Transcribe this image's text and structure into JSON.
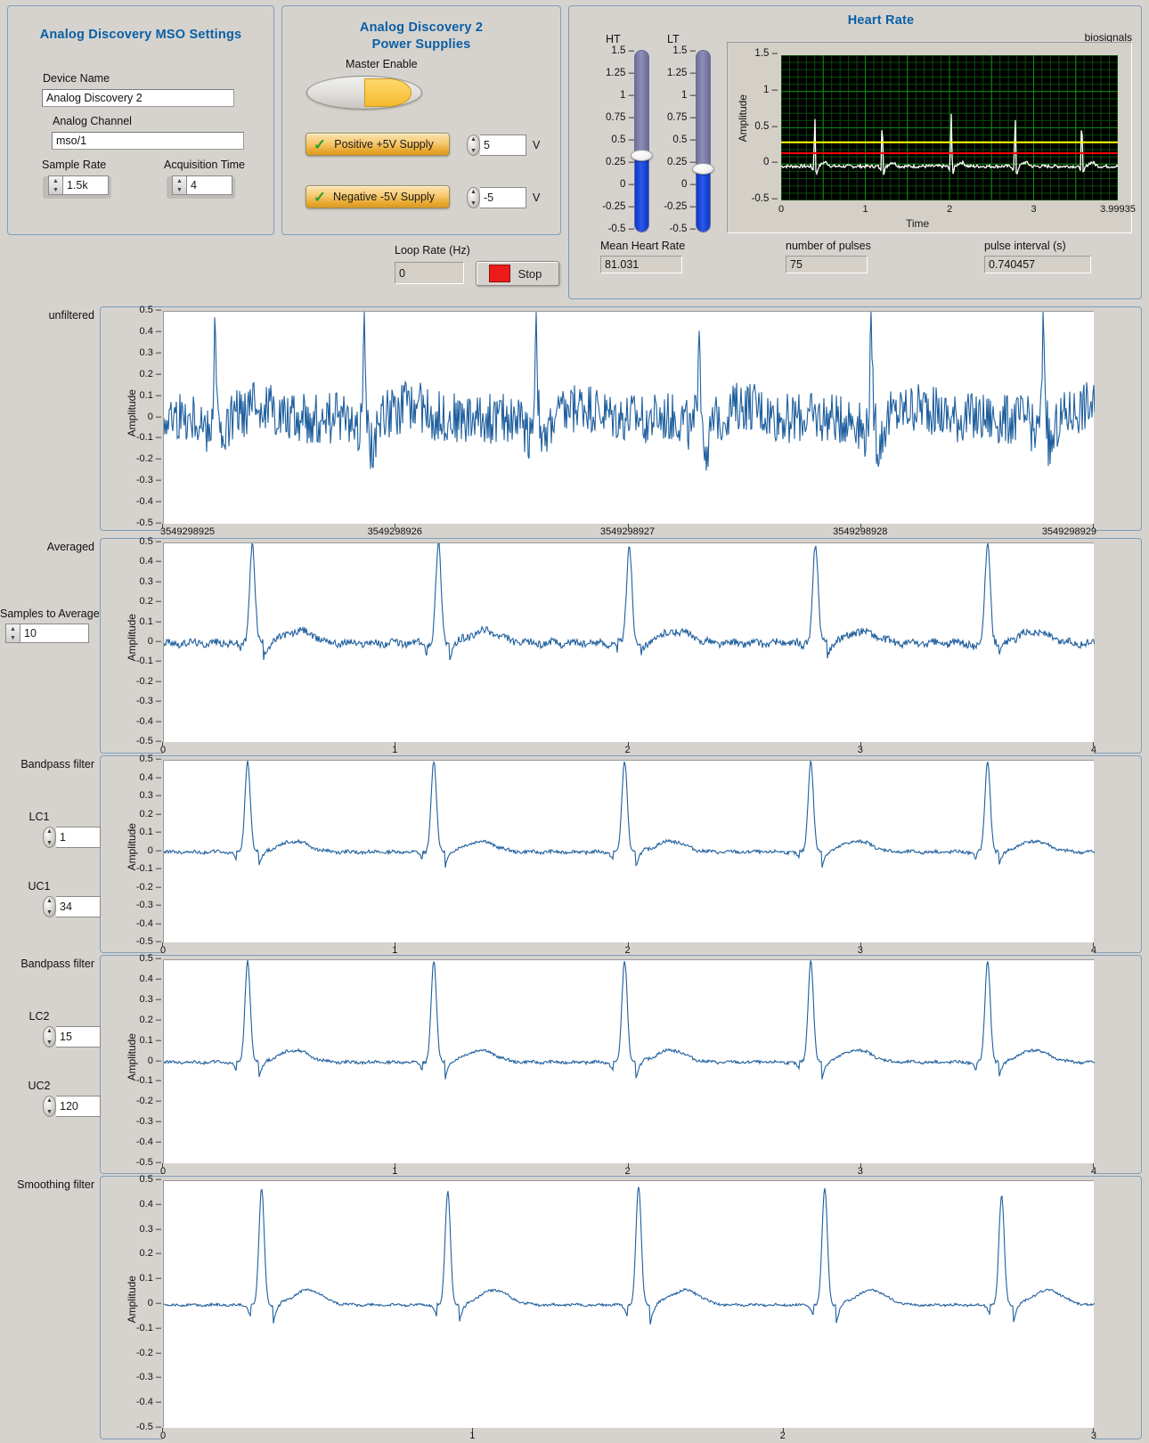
{
  "mso_settings": {
    "title": "Analog Discovery MSO Settings",
    "device_name_label": "Device Name",
    "device_name_value": "Analog Discovery 2",
    "analog_channel_label": "Analog Channel",
    "analog_channel_value": "mso/1",
    "sample_rate_label": "Sample Rate",
    "sample_rate_value": "1.5k",
    "acquisition_time_label": "Acquisition Time",
    "acquisition_time_value": "4"
  },
  "power_supplies": {
    "title_line1": "Analog Discovery 2",
    "title_line2": "Power Supplies",
    "master_enable_label": "Master Enable",
    "positive_supply_label": "Positive +5V Supply",
    "negative_supply_label": "Negative -5V Supply",
    "positive_voltage_value": "5",
    "negative_voltage_value": "-5",
    "volt_unit": "V"
  },
  "loop": {
    "loop_rate_label": "Loop Rate (Hz)",
    "loop_rate_value": "0",
    "stop_label": "Stop"
  },
  "heart_rate": {
    "title": "Heart Rate",
    "ht_label": "HT",
    "lt_label": "LT",
    "ht_value": 0.3,
    "lt_value": 0.15,
    "slider_ticks": [
      "1.5",
      "1.25",
      "1",
      "0.75",
      "0.5",
      "0.25",
      "0",
      "-0.25",
      "-0.5"
    ],
    "legend": "biosignals",
    "mean_heart_rate_label": "Mean Heart Rate",
    "mean_heart_rate_value": "81.031",
    "number_of_pulses_label": "number of pulses",
    "number_of_pulses_value": "75",
    "pulse_interval_label": "pulse interval (s)",
    "pulse_interval_value": "0.740457"
  },
  "chart_data": [
    {
      "type": "line",
      "name": "heart-rate-chart",
      "title": "",
      "xlabel": "Time",
      "ylabel": "Amplitude",
      "xlim": [
        0,
        3.99935
      ],
      "ylim": [
        -0.5,
        1.5
      ],
      "xticks": [
        "0",
        "1",
        "2",
        "3",
        "3.99935"
      ],
      "yticks": [
        "1.5",
        "1",
        "0.5",
        "0",
        "-0.5"
      ],
      "grid": true,
      "grid_color": "#0c6b0c",
      "background": "#000000",
      "trace_color": "#ffffff",
      "threshold_lines": [
        {
          "name": "HT",
          "value": 0.3,
          "color": "#ffff00"
        },
        {
          "name": "LT",
          "value": 0.15,
          "color": "#ff0000"
        }
      ],
      "peak_times": [
        0.4,
        1.2,
        2.02,
        2.78,
        3.57
      ],
      "peak_amplitudes": [
        0.7,
        0.66,
        0.72,
        0.67,
        0.66
      ]
    },
    {
      "type": "line",
      "name": "unfiltered-graph",
      "side_label": "unfiltered",
      "ylabel": "Amplitude",
      "ylim": [
        -0.5,
        0.5
      ],
      "yticks": [
        "0.5",
        "0.4",
        "0.3",
        "0.2",
        "0.1",
        "0",
        "-0.1",
        "-0.2",
        "-0.3",
        "-0.4",
        "-0.5"
      ],
      "xticks": [
        "3549298925",
        "3549298926",
        "3549298927",
        "3549298928",
        "3549298929"
      ],
      "trace_color": "#1f5f9e",
      "noise_amplitude": 0.12,
      "peak_positions": [
        0.055,
        0.215,
        0.4,
        0.575,
        0.76,
        0.945
      ],
      "peak_amplitudes": [
        0.5,
        0.5,
        0.5,
        0.5,
        0.5,
        0.5
      ]
    },
    {
      "type": "line",
      "name": "averaged-graph",
      "side_label": "Averaged",
      "ylabel": "Amplitude",
      "ylim": [
        -0.5,
        0.5
      ],
      "yticks": [
        "0.5",
        "0.4",
        "0.3",
        "0.2",
        "0.1",
        "0",
        "-0.1",
        "-0.2",
        "-0.3",
        "-0.4",
        "-0.5"
      ],
      "xticks": [
        "0",
        "1",
        "2",
        "3",
        "4"
      ],
      "trace_color": "#1f5f9e",
      "noise_amplitude": 0.03,
      "peak_positions": [
        0.095,
        0.295,
        0.5,
        0.7,
        0.885
      ],
      "peak_amplitudes": [
        0.5,
        0.5,
        0.5,
        0.5,
        0.5
      ],
      "control_label": "Samples to Average",
      "control_value": "10"
    },
    {
      "type": "line",
      "name": "bandpass-filter-1-graph",
      "side_label": "Bandpass filter",
      "ylabel": "Amplitude",
      "ylim": [
        -0.5,
        0.5
      ],
      "yticks": [
        "0.5",
        "0.4",
        "0.3",
        "0.2",
        "0.1",
        "0",
        "-0.1",
        "-0.2",
        "-0.3",
        "-0.4",
        "-0.5"
      ],
      "xticks": [
        "0",
        "1",
        "2",
        "3",
        "4"
      ],
      "trace_color": "#1f5f9e",
      "noise_amplitude": 0.015,
      "peak_positions": [
        0.09,
        0.29,
        0.495,
        0.695,
        0.885
      ],
      "peak_amplitudes": [
        0.5,
        0.5,
        0.5,
        0.5,
        0.5
      ],
      "controls": [
        {
          "label": "LC1",
          "value": "1"
        },
        {
          "label": "UC1",
          "value": "34"
        }
      ]
    },
    {
      "type": "line",
      "name": "bandpass-filter-2-graph",
      "side_label": "Bandpass filter",
      "ylabel": "Amplitude",
      "ylim": [
        -0.5,
        0.5
      ],
      "yticks": [
        "0.5",
        "0.4",
        "0.3",
        "0.2",
        "0.1",
        "0",
        "-0.1",
        "-0.2",
        "-0.3",
        "-0.4",
        "-0.5"
      ],
      "xticks": [
        "0",
        "1",
        "2",
        "3",
        "4"
      ],
      "trace_color": "#1f5f9e",
      "noise_amplitude": 0.012,
      "peak_positions": [
        0.09,
        0.29,
        0.495,
        0.695,
        0.885
      ],
      "peak_amplitudes": [
        0.5,
        0.5,
        0.5,
        0.5,
        0.5
      ],
      "controls": [
        {
          "label": "LC2",
          "value": "15"
        },
        {
          "label": "UC2",
          "value": "120"
        }
      ]
    },
    {
      "type": "line",
      "name": "smoothing-filter-graph",
      "side_label": "Smoothing filter",
      "ylabel": "Amplitude",
      "ylim": [
        -0.5,
        0.5
      ],
      "yticks": [
        "0.5",
        "0.4",
        "0.3",
        "0.2",
        "0.1",
        "0",
        "-0.1",
        "-0.2",
        "-0.3",
        "-0.4",
        "-0.5"
      ],
      "xticks": [
        "0",
        "1",
        "2",
        "3"
      ],
      "trace_color": "#1f5f9e",
      "noise_amplitude": 0.008,
      "peak_positions": [
        0.105,
        0.305,
        0.51,
        0.71,
        0.9
      ],
      "peak_amplitudes": [
        0.47,
        0.46,
        0.48,
        0.47,
        0.44
      ]
    }
  ]
}
